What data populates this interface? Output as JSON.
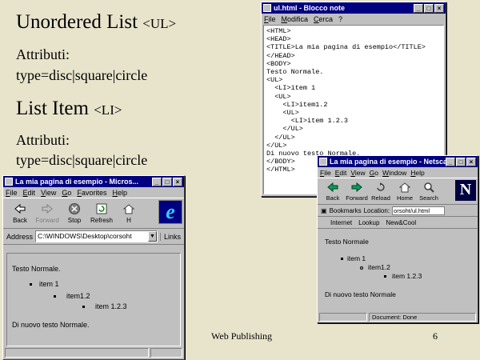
{
  "slide": {
    "heading_ul": "Unordered List",
    "heading_ul_tag": "<UL>",
    "ul_attr_label": "Attributi:",
    "ul_attr_value": "type=disc|square|circle",
    "heading_li": "List Item",
    "heading_li_tag": "<LI>",
    "li_attr_label": "Attributi:",
    "li_attr_value": "type=disc|square|circle",
    "footer_title": "Web Publishing",
    "footer_page": "6"
  },
  "notepad": {
    "title": "ul.html - Blocco note",
    "menu": [
      "File",
      "Modifica",
      "Cerca",
      "?"
    ],
    "lines": [
      "<HTML>",
      "<HEAD>",
      "<TITLE>La mia pagina di esempio</TITLE>",
      "</HEAD>",
      "<BODY>",
      "Testo Normale.",
      "<UL>",
      "  <LI>item 1",
      "  <UL>",
      "    <LI>item1.2",
      "    <UL>",
      "      <LI>item 1.2.3",
      "    </UL>",
      "  </UL>",
      "</UL>",
      "Di nuovo testo Normale.",
      "</BODY>",
      "</HTML>"
    ]
  },
  "ie": {
    "title": "La mia pagina di esempio - Micros...",
    "menu": [
      "File",
      "Edit",
      "View",
      "Go",
      "Favorites",
      "Help"
    ],
    "toolbar": [
      "Back",
      "Forward",
      "Stop",
      "Refresh",
      "H"
    ],
    "address_label": "Address",
    "address_value": "C:\\WINDOWS\\Desktop\\corsoht",
    "links_label": "Links",
    "page": {
      "text_before": "Testo Normale.",
      "item1": "item 1",
      "item12": "item1.2",
      "item123": "item 1.2.3",
      "text_after": "Di nuovo testo Normale."
    }
  },
  "ns": {
    "title": "La mia pagina di esempio - Netscape",
    "menu": [
      "File",
      "Edit",
      "View",
      "Go",
      "Window",
      "Help"
    ],
    "toolbar": [
      "Back",
      "Forward",
      "Reload",
      "Home",
      "Search"
    ],
    "bookmarks_label": "Bookmarks",
    "location_label": "Location:",
    "location_value": "orsoht/ul.html",
    "personal": [
      "Internet",
      "Lookup",
      "New&Cool"
    ],
    "page": {
      "text_before": "Testo Normale",
      "item1": "item 1",
      "item12": "item1.2",
      "item123": "item 1.2.3",
      "text_after": "Di nuovo testo Normale"
    },
    "status": "Document: Done"
  },
  "icons": {
    "ie_logo": "e",
    "ns_logo": "N"
  }
}
